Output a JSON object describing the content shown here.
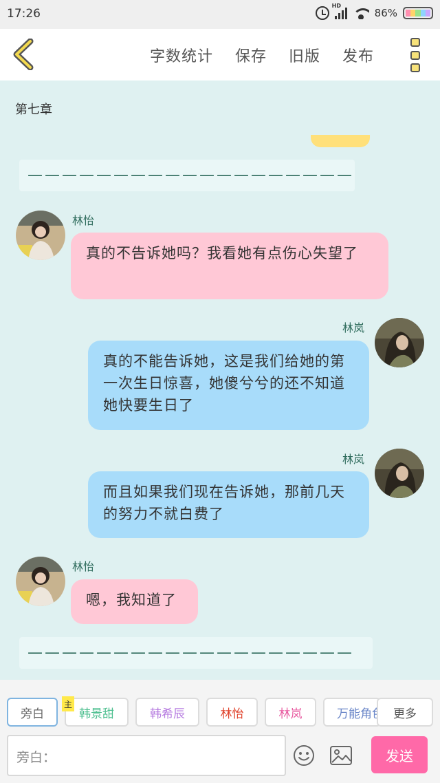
{
  "status_bar": {
    "time": "17:26",
    "network": "HD",
    "battery": "86%"
  },
  "toolbar": {
    "back_icon": "chevron-left-icon",
    "word_count_label": "字数统计",
    "save_label": "保存",
    "old_version_label": "旧版",
    "publish_label": "发布",
    "menu_icon": "more-menu-icon"
  },
  "chapter": {
    "title": "第七章"
  },
  "dividers": {
    "top": "———————————————————",
    "bottom": "———————————————————"
  },
  "messages": [
    {
      "speaker": "林怡",
      "side": "left",
      "color": "pink",
      "text": "真的不告诉她吗？我看她有点伤心失望了"
    },
    {
      "speaker": "林岚",
      "side": "right",
      "color": "blue",
      "text": "真的不能告诉她，这是我们给她的第一次生日惊喜，她傻兮兮的还不知道她快要生日了"
    },
    {
      "speaker": "林岚",
      "side": "right",
      "color": "blue",
      "text": "而且如果我们现在告诉她，那前几天的努力不就白费了"
    },
    {
      "speaker": "林怡",
      "side": "left",
      "color": "pink",
      "text": "嗯，我知道了"
    }
  ],
  "characters": {
    "main_tag": "主",
    "items": [
      {
        "label": "旁白",
        "color": "#666666",
        "active": true
      },
      {
        "label": "韩景甜",
        "color": "#4dbf8f"
      },
      {
        "label": "韩希辰",
        "color": "#b77de0"
      },
      {
        "label": "林怡",
        "color": "#e0442d"
      },
      {
        "label": "林岚",
        "color": "#e85aa0"
      },
      {
        "label": "万能角色",
        "color": "#6a86c8"
      }
    ],
    "more_label": "更多"
  },
  "composer": {
    "placeholder": "旁白：",
    "send_label": "发送",
    "emoji_icon": "smiley-icon",
    "image_icon": "image-icon"
  },
  "colors": {
    "background": "#dff1f1",
    "pink_bubble": "#ffc8d6",
    "blue_bubble": "#a8dcfa",
    "send_button": "#ff69a8",
    "accent_yellow": "#ffe07a"
  }
}
